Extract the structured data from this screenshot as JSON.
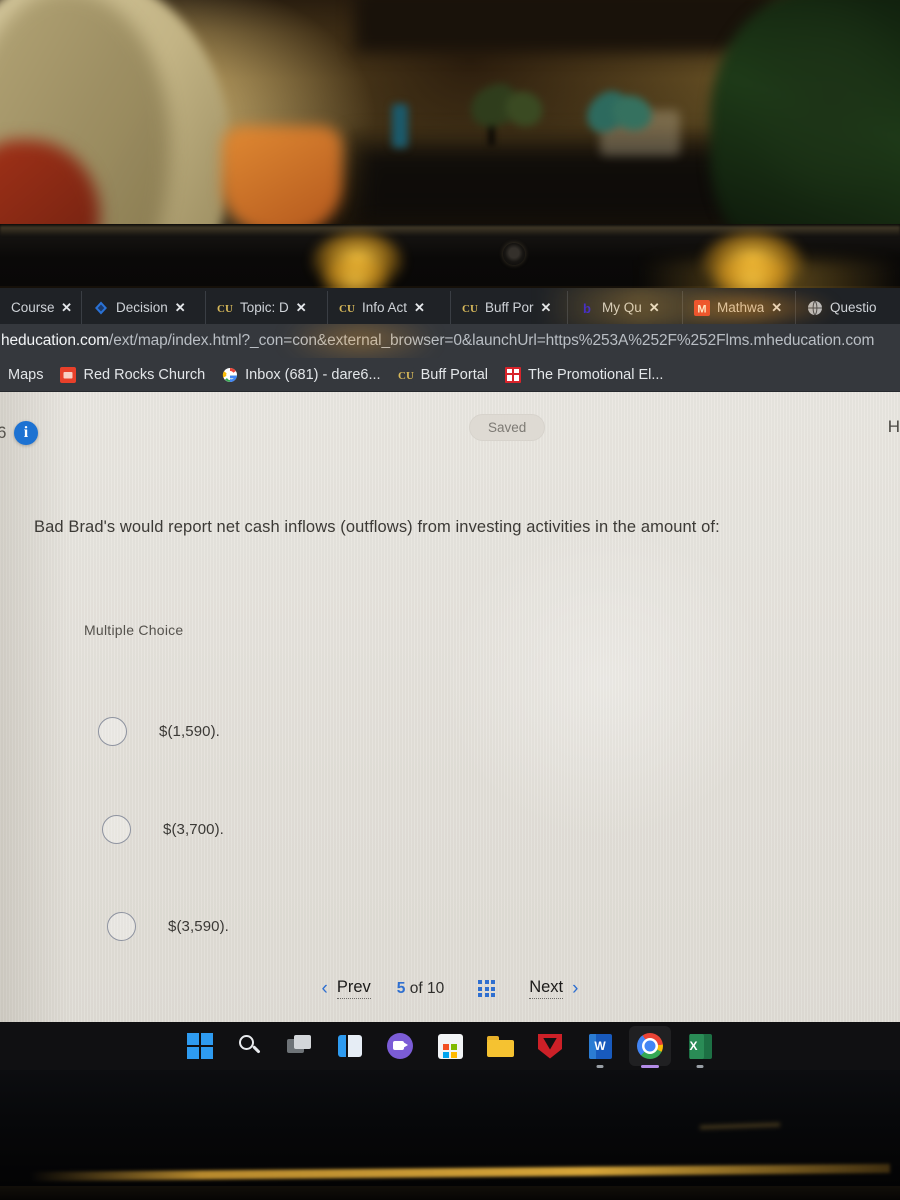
{
  "browser": {
    "tabs": [
      {
        "label": "Course ",
        "favicon": "none-icon",
        "close": "✕"
      },
      {
        "label": "Decision",
        "favicon": "decision-diamond-icon",
        "close": "✕"
      },
      {
        "label": "Topic: D",
        "favicon": "cu-buffs-icon",
        "close": "✕"
      },
      {
        "label": "Info Act",
        "favicon": "cu-buffs-icon",
        "close": "✕"
      },
      {
        "label": "Buff Por",
        "favicon": "cu-buffs-icon",
        "close": "✕"
      },
      {
        "label": "My Qu",
        "favicon": "bold-b-icon",
        "close": "✕"
      },
      {
        "label": "Mathwa",
        "favicon": "mathway-m-icon",
        "close": "✕"
      },
      {
        "label": "Questio",
        "favicon": "globe-icon",
        "close": ""
      }
    ],
    "url": {
      "domain": "heducation.com",
      "path": "/ext/map/index.html?_con=con&external_browser=0&launchUrl=https%253A%252F%252Flms.mheducation.com"
    },
    "bookmarks": [
      {
        "label": "Maps",
        "favicon": "none-icon"
      },
      {
        "label": "Red Rocks Church",
        "favicon": "red-square-icon"
      },
      {
        "label": "Inbox (681) - dare6...",
        "favicon": "google-g-icon"
      },
      {
        "label": "Buff Portal",
        "favicon": "cu-buffs-icon"
      },
      {
        "label": "The Promotional El...",
        "favicon": "red-grid-icon"
      }
    ]
  },
  "page": {
    "question_number": "6",
    "info_icon_glyph": "i",
    "saved_label": "Saved",
    "help_label": "H",
    "question_text": "Bad Brad's would report net cash inflows (outflows) from investing activities in the amount of:",
    "answer_type_label": "Multiple Choice",
    "choices": [
      {
        "label": "$(1,590)."
      },
      {
        "label": "$(3,700)."
      },
      {
        "label": "$(3,590)."
      }
    ],
    "nav": {
      "prev_label": "Prev",
      "prev_chevron": "‹",
      "current_page": "5",
      "of_label": "of",
      "total_pages": "10",
      "grid_icon": "grid-menu-icon",
      "next_label": "Next",
      "next_chevron": "›"
    }
  },
  "taskbar": {
    "items": [
      {
        "name": "start-button",
        "icon": "windows-logo-icon"
      },
      {
        "name": "search-button",
        "icon": "search-icon"
      },
      {
        "name": "task-view-button",
        "icon": "task-view-icon"
      },
      {
        "name": "widgets-button",
        "icon": "widgets-icon"
      },
      {
        "name": "teams-button",
        "icon": "teams-icon"
      },
      {
        "name": "microsoft-store-button",
        "icon": "store-icon"
      },
      {
        "name": "file-explorer-button",
        "icon": "folder-icon"
      },
      {
        "name": "mcafee-button",
        "icon": "mcafee-shield-icon"
      },
      {
        "name": "word-button",
        "icon": "word-icon",
        "glyph": "W"
      },
      {
        "name": "chrome-button",
        "icon": "chrome-icon"
      },
      {
        "name": "excel-button",
        "icon": "excel-icon",
        "glyph": "X"
      }
    ]
  },
  "colors": {
    "accent_blue": "#2f6fd0",
    "tab_bar": "#1f2226",
    "url_bar": "#35383d",
    "page_bg": "#e6e3dd",
    "info_blue": "#1d72d2",
    "taskbar": "#101012"
  }
}
